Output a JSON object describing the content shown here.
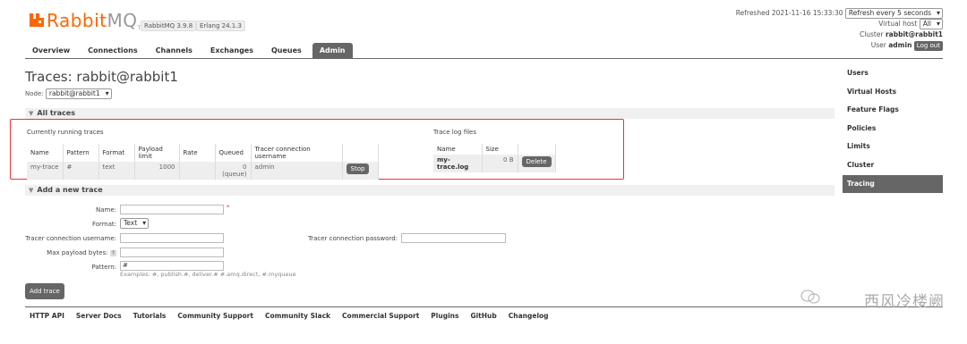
{
  "header": {
    "logo_rabbit": "Rabbit",
    "logo_mq": "MQ",
    "logo_tm": "TM",
    "version_rabbitmq": "RabbitMQ 3.9.8",
    "version_erlang": "Erlang 24.1.3",
    "refreshed": "Refreshed 2021-11-16 15:33:30",
    "refresh_select": "Refresh every 5 seconds",
    "vhost_label": "Virtual host",
    "vhost_value": "All",
    "cluster_label": "Cluster",
    "cluster_value": "rabbit@rabbit1",
    "user_label": "User",
    "user_value": "admin",
    "logout_label": "Log out"
  },
  "tabs": [
    "Overview",
    "Connections",
    "Channels",
    "Exchanges",
    "Queues",
    "Admin"
  ],
  "page": {
    "title": "Traces: rabbit@rabbit1",
    "node_label": "Node:",
    "node_value": "rabbit@rabbit1"
  },
  "all_traces": {
    "header": "All traces",
    "running_title": "Currently running traces",
    "running_columns": [
      "Name",
      "Pattern",
      "Format",
      "Payload limit",
      "Rate",
      "Queued",
      "Tracer connection username",
      ""
    ],
    "running_row": {
      "name": "my-trace",
      "pattern": "#",
      "format": "text",
      "payload_limit": "1000",
      "rate": "",
      "queued": "0",
      "queued_sub": "(queue)",
      "username": "admin",
      "stop_label": "Stop"
    },
    "log_title": "Trace log files",
    "log_columns": [
      "Name",
      "Size",
      ""
    ],
    "log_row": {
      "name": "my-trace.log",
      "size": "0 B",
      "delete_label": "Delete"
    }
  },
  "add_trace": {
    "header": "Add a new trace",
    "name_label": "Name:",
    "required_mark": "*",
    "format_label": "Format:",
    "format_value": "Text",
    "tracer_user_label": "Tracer connection username:",
    "tracer_pass_label": "Tracer connection password:",
    "max_payload_label": "Max payload bytes:",
    "help_mark": "?",
    "pattern_label": "Pattern:",
    "pattern_value": "#",
    "pattern_hint": "Examples: #, publish.#, deliver.# #.amq.direct, #.myqueue",
    "add_button": "Add trace"
  },
  "footer": [
    "HTTP API",
    "Server Docs",
    "Tutorials",
    "Community Support",
    "Community Slack",
    "Commercial Support",
    "Plugins",
    "GitHub",
    "Changelog"
  ],
  "sidebar": [
    "Users",
    "Virtual Hosts",
    "Feature Flags",
    "Policies",
    "Limits",
    "Cluster",
    "Tracing"
  ],
  "watermark": "西风冷楼阙",
  "colors": {
    "brand": "#ff6600",
    "active": "#666666",
    "highlight": "#ee3333"
  }
}
